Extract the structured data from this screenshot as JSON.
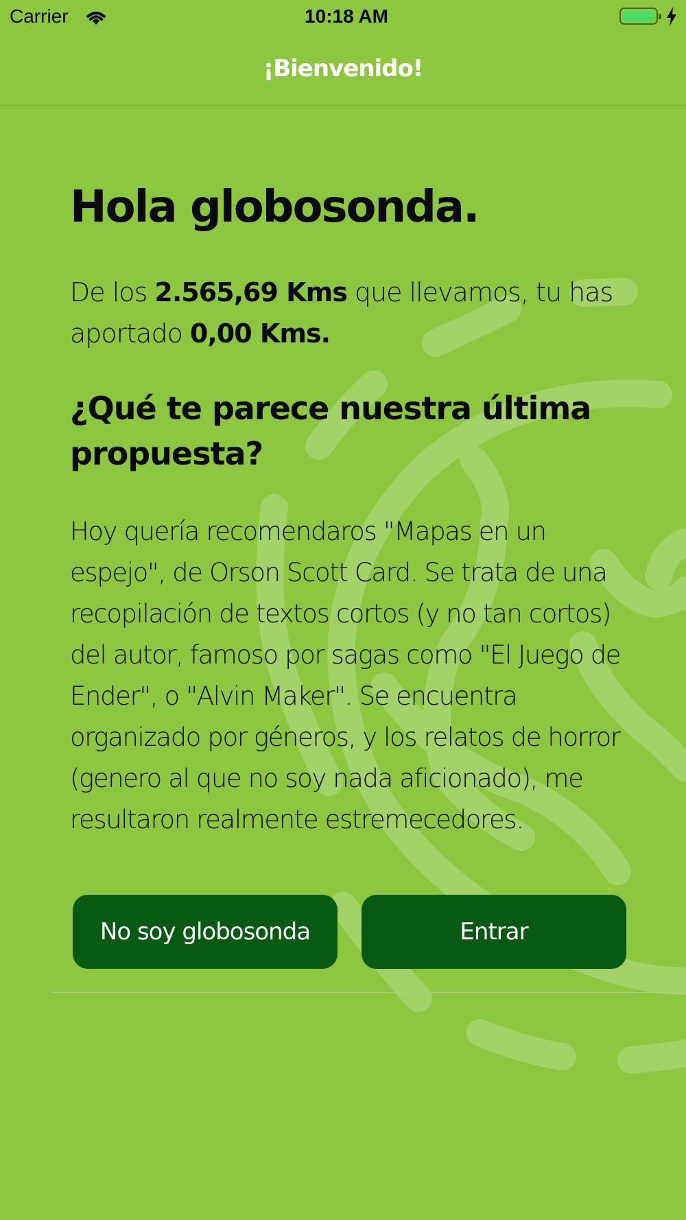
{
  "status_bar": {
    "carrier": "Carrier",
    "time": "10:18 AM",
    "wifi_icon": "wifi-icon",
    "battery_icon": "battery-icon",
    "charging_icon": "bolt-icon"
  },
  "nav": {
    "title": "¡Bienvenido!"
  },
  "main": {
    "greeting": "Hola globosonda.",
    "stats_prefix": "De los ",
    "stats_total": "2.565,69 Kms",
    "stats_middle": " que llevamos, tu has aportado ",
    "stats_user": "0,00 Kms.",
    "question": "¿Qué te parece nuestra última propuesta?",
    "body": "Hoy quería recomendaros \"Mapas en un espejo\", de Orson Scott Card. Se trata de una recopilación de textos cortos (y no tan cortos) del autor, famoso por sagas como \"El Juego de Ender\", o \"Alvin Maker\". Se encuentra organizado por géneros, y los relatos de horror (genero al que no soy nada aficionado), me resultaron realmente estremecedores."
  },
  "actions": {
    "not_me_label": "No soy globosonda",
    "enter_label": "Entrar"
  },
  "colors": {
    "background": "#8dc63f",
    "button": "#085a12",
    "decor": "#a6d46e"
  }
}
